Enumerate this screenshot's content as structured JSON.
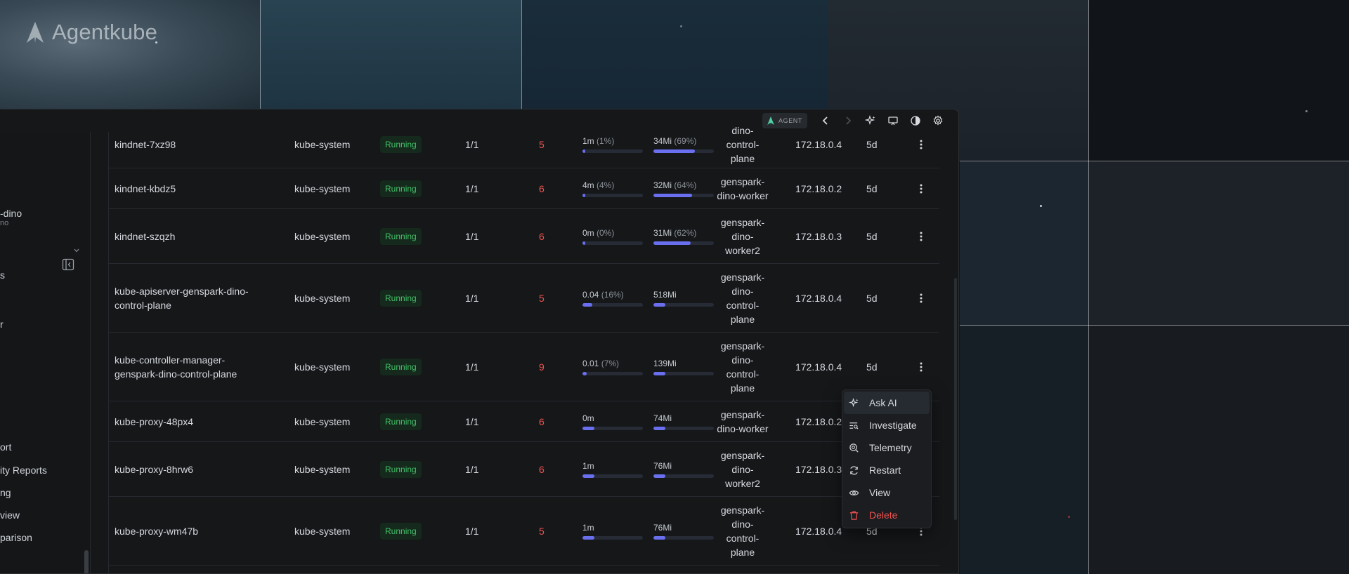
{
  "brand": {
    "name": "Agentkube"
  },
  "titlebar": {
    "agent_label": "AGENT"
  },
  "sidebar": {
    "cluster_name": "-dino",
    "cluster_sub": "no",
    "items": [
      {
        "label": "s"
      },
      {
        "label": "r"
      },
      {
        "label": "ort"
      },
      {
        "label": "ity Reports"
      },
      {
        "label": "ng"
      },
      {
        "label": "view"
      },
      {
        "label": "parison"
      }
    ]
  },
  "colors": {
    "running_badge_bg": "#15291c",
    "running_badge_text": "#45c26a",
    "restarts": "#ef5350",
    "bar": "#6a6ff0"
  },
  "pods": [
    {
      "name": "kindnet-7xz98",
      "namespace": "kube-system",
      "status": "Running",
      "ready": "1/1",
      "restarts": "5",
      "cpu": "1m",
      "cpu_pct": "(1%)",
      "cpu_fill": 0.02,
      "mem": "34Mi",
      "mem_pct": "(69%)",
      "mem_fill": 0.69,
      "node": "dino-\ncontrol-\nplane",
      "ip": "172.18.0.4",
      "age": "5d"
    },
    {
      "name": "kindnet-kbdz5",
      "namespace": "kube-system",
      "status": "Running",
      "ready": "1/1",
      "restarts": "6",
      "cpu": "4m",
      "cpu_pct": "(4%)",
      "cpu_fill": 0.04,
      "mem": "32Mi",
      "mem_pct": "(64%)",
      "mem_fill": 0.64,
      "node": "genspark-\ndino-worker",
      "ip": "172.18.0.2",
      "age": "5d"
    },
    {
      "name": "kindnet-szqzh",
      "namespace": "kube-system",
      "status": "Running",
      "ready": "1/1",
      "restarts": "6",
      "cpu": "0m",
      "cpu_pct": "(0%)",
      "cpu_fill": 0.01,
      "mem": "31Mi",
      "mem_pct": "(62%)",
      "mem_fill": 0.62,
      "node": "genspark-\ndino-\nworker2",
      "ip": "172.18.0.3",
      "age": "5d"
    },
    {
      "name": "kube-apiserver-genspark-dino-control-plane",
      "namespace": "kube-system",
      "status": "Running",
      "ready": "1/1",
      "restarts": "5",
      "cpu": "0.04",
      "cpu_pct": "(16%)",
      "cpu_fill": 0.16,
      "mem": "518Mi",
      "mem_pct": "",
      "mem_fill": 0.2,
      "node": "genspark-\ndino-\ncontrol-\nplane",
      "ip": "172.18.0.4",
      "age": "5d"
    },
    {
      "name": "kube-controller-manager-genspark-dino-control-plane",
      "namespace": "kube-system",
      "status": "Running",
      "ready": "1/1",
      "restarts": "9",
      "cpu": "0.01",
      "cpu_pct": "(7%)",
      "cpu_fill": 0.07,
      "mem": "139Mi",
      "mem_pct": "",
      "mem_fill": 0.2,
      "node": "genspark-\ndino-\ncontrol-\nplane",
      "ip": "172.18.0.4",
      "age": "5d"
    },
    {
      "name": "kube-proxy-48px4",
      "namespace": "kube-system",
      "status": "Running",
      "ready": "1/1",
      "restarts": "6",
      "cpu": "0m",
      "cpu_pct": "",
      "cpu_fill": 0.2,
      "mem": "74Mi",
      "mem_pct": "",
      "mem_fill": 0.2,
      "node": "genspark-\ndino-worker",
      "ip": "172.18.0.2",
      "age": ""
    },
    {
      "name": "kube-proxy-8hrw6",
      "namespace": "kube-system",
      "status": "Running",
      "ready": "1/1",
      "restarts": "6",
      "cpu": "1m",
      "cpu_pct": "",
      "cpu_fill": 0.2,
      "mem": "76Mi",
      "mem_pct": "",
      "mem_fill": 0.2,
      "node": "genspark-\ndino-\nworker2",
      "ip": "172.18.0.3",
      "age": ""
    },
    {
      "name": "kube-proxy-wm47b",
      "namespace": "kube-system",
      "status": "Running",
      "ready": "1/1",
      "restarts": "5",
      "cpu": "1m",
      "cpu_pct": "",
      "cpu_fill": 0.2,
      "mem": "76Mi",
      "mem_pct": "",
      "mem_fill": 0.2,
      "node": "genspark-\ndino-\ncontrol-\nplane",
      "ip": "172.18.0.4",
      "age": "5d"
    }
  ],
  "context_menu": {
    "items": [
      {
        "label": "Ask AI",
        "icon": "sparkle-icon"
      },
      {
        "label": "Investigate",
        "icon": "investigate-icon"
      },
      {
        "label": "Telemetry",
        "icon": "zoom-icon"
      },
      {
        "label": "Restart",
        "icon": "refresh-icon"
      },
      {
        "label": "View",
        "icon": "eye-icon"
      },
      {
        "label": "Delete",
        "icon": "trash-icon"
      }
    ]
  }
}
